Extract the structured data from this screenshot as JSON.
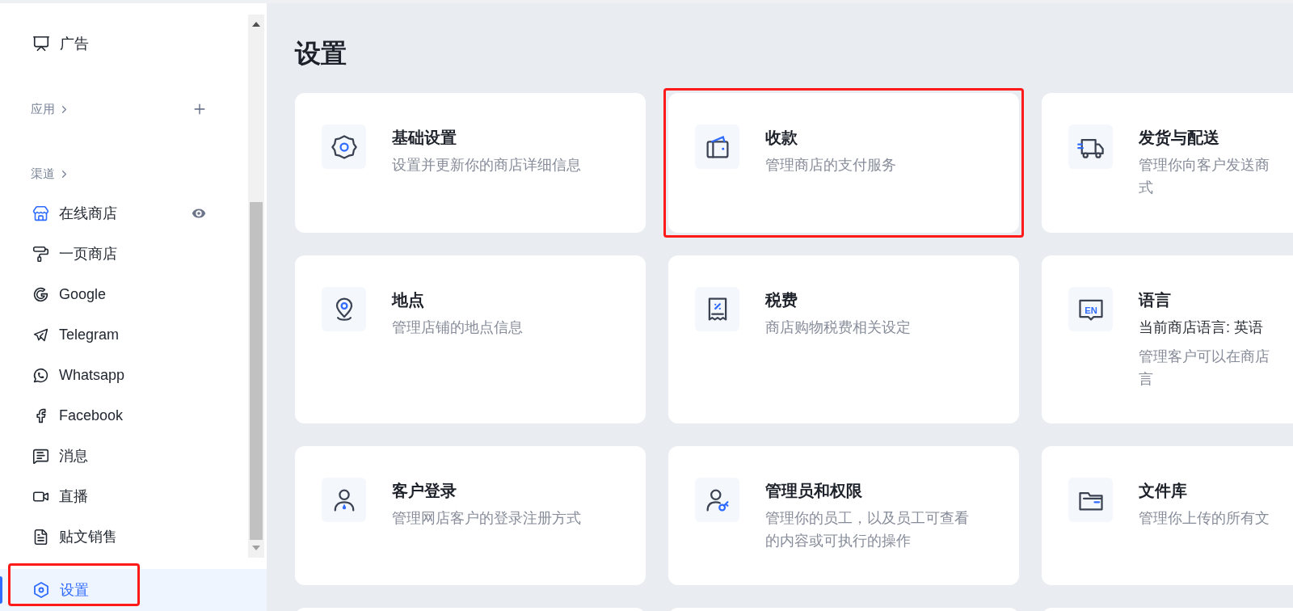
{
  "sidebar": {
    "top_items": [
      {
        "label": "广告",
        "selected": false
      }
    ],
    "apps": {
      "label": "应用",
      "can_add": true
    },
    "channels": {
      "label": "渠道",
      "items": [
        {
          "label": "在线商店",
          "selected": false,
          "preview": true
        },
        {
          "label": "一页商店",
          "selected": false,
          "preview": false
        },
        {
          "label": "Google",
          "selected": false,
          "preview": false
        },
        {
          "label": "Telegram",
          "selected": false,
          "preview": false
        },
        {
          "label": "Whatsapp",
          "selected": false,
          "preview": false
        },
        {
          "label": "Facebook",
          "selected": false,
          "preview": false
        },
        {
          "label": "消息",
          "selected": false,
          "preview": false
        },
        {
          "label": "直播",
          "selected": false,
          "preview": false
        },
        {
          "label": "贴文销售",
          "selected": false,
          "preview": false
        }
      ]
    },
    "settings_item": {
      "label": "设置",
      "selected": true,
      "highlighted": true
    }
  },
  "page": {
    "title": "设置",
    "cards": [
      {
        "title": "基础设置",
        "description": [
          "设置并更新你的商店详细信息"
        ],
        "highlighted": false
      },
      {
        "title": "收款",
        "description": [
          "管理商店的支付服务"
        ],
        "highlighted": true
      },
      {
        "title": "发货与配送",
        "description": [
          "管理你向客户发送商",
          "式"
        ],
        "highlighted": false
      },
      {
        "title": "地点",
        "description": [
          "管理店铺的地点信息"
        ],
        "highlighted": false
      },
      {
        "title": "税费",
        "description": [
          "商店购物税费相关设定"
        ],
        "highlighted": false
      },
      {
        "title": "语言",
        "icon_text": "EN",
        "subtitle": "当前商店语言: 英语",
        "description": [
          "管理客户可以在商店",
          "言"
        ],
        "highlighted": false
      },
      {
        "title": "客户登录",
        "description": [
          "管理网店客户的登录注册方式"
        ],
        "highlighted": false
      },
      {
        "title": "管理员和权限",
        "description": [
          "管理你的员工，以及员工可查看",
          "的内容或可执行的操作"
        ],
        "highlighted": false
      },
      {
        "title": "文件库",
        "description": [
          "管理你上传的所有文"
        ],
        "highlighted": false
      }
    ]
  }
}
